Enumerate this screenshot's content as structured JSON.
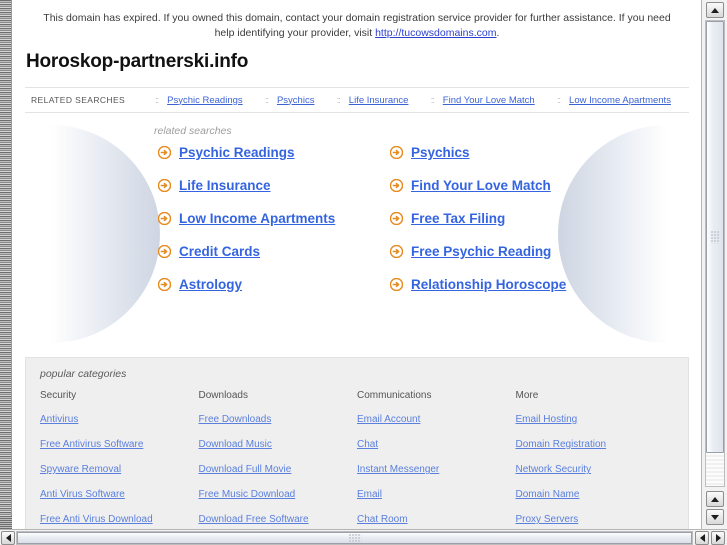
{
  "banner": {
    "text_before": "This domain has expired. If you owned this domain, contact your domain registration service provider for further assistance. If you need help identifying your provider, visit ",
    "link_label": "http://tucowsdomains.com",
    "text_after": "."
  },
  "page_title": "Horoskop-partnerski.info",
  "related_nav": {
    "label": "RELATED SEARCHES",
    "separator": "::",
    "items": [
      {
        "label": "Psychic Readings"
      },
      {
        "label": "Psychics"
      },
      {
        "label": "Life Insurance"
      },
      {
        "label": "Find Your Love Match"
      },
      {
        "label": "Low Income Apartments"
      }
    ]
  },
  "searches": {
    "heading": "related searches",
    "icon": "arrow-circle-right-icon",
    "items": [
      {
        "label": "Psychic Readings"
      },
      {
        "label": "Psychics"
      },
      {
        "label": "Life Insurance"
      },
      {
        "label": "Find Your Love Match"
      },
      {
        "label": "Low Income Apartments"
      },
      {
        "label": "Free Tax Filing"
      },
      {
        "label": "Credit Cards"
      },
      {
        "label": "Free Psychic Reading"
      },
      {
        "label": "Astrology"
      },
      {
        "label": "Relationship Horoscope"
      }
    ]
  },
  "popular_categories": {
    "heading": "popular categories",
    "columns": [
      {
        "title": "Security",
        "links": [
          "Antivirus",
          "Free Antivirus Software",
          "Spyware Removal",
          "Anti Virus Software",
          "Free Anti Virus Download"
        ]
      },
      {
        "title": "Downloads",
        "links": [
          "Free Downloads",
          "Download Music",
          "Download Full Movie",
          "Free Music Download",
          "Download Free Software"
        ]
      },
      {
        "title": "Communications",
        "links": [
          "Email Account",
          "Chat",
          "Instant Messenger",
          "Email",
          "Chat Room"
        ]
      },
      {
        "title": "More",
        "links": [
          "Email Hosting",
          "Domain Registration",
          "Network Security",
          "Domain Name",
          "Proxy Servers"
        ]
      }
    ]
  },
  "colors": {
    "link_blue": "#3464e0",
    "nav_link_blue": "#3c63d4",
    "category_link_blue": "#5a7fdd",
    "bullet_orange": "#f08a1e",
    "panel_gray": "#efefef"
  },
  "scrollbars": {
    "vertical": {
      "up_icon": "triangle-up-icon",
      "down_icon": "triangle-down-icon"
    },
    "horizontal": {
      "left_icon": "triangle-left-icon",
      "right_icon": "triangle-right-icon"
    }
  }
}
